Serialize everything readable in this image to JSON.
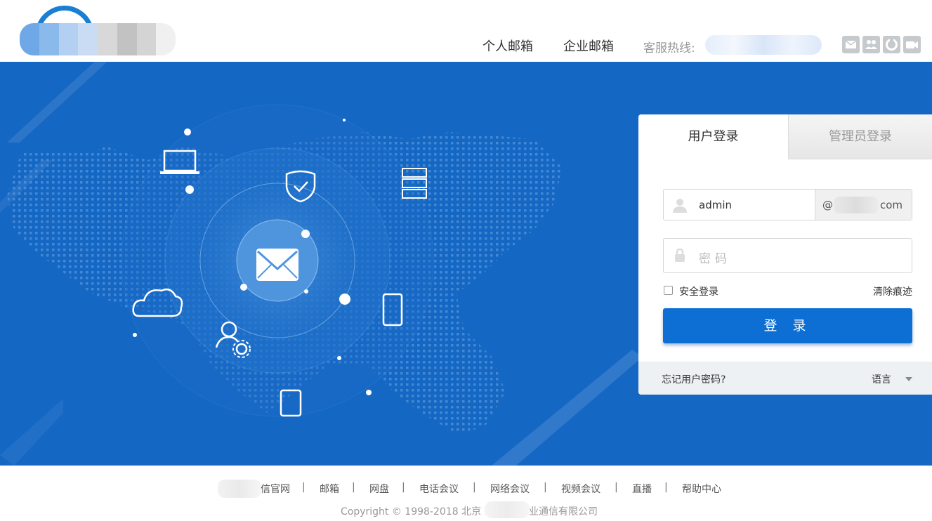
{
  "header": {
    "nav_personal": "个人邮箱",
    "nav_enterprise": "企业邮箱",
    "hotline_label": "客服热线:",
    "icons": [
      "mail-icon",
      "contacts-icon",
      "sync-icon",
      "video-icon"
    ]
  },
  "login": {
    "tab_user": "用户登录",
    "tab_admin": "管理员登录",
    "username_value": "admin",
    "domain_at": "@",
    "domain_suffix": "com",
    "password_placeholder": "密码",
    "secure_login_label": "安全登录",
    "clear_traces": "清除痕迹",
    "login_button": "登 录",
    "forgot_password": "忘记用户密码?",
    "language": "语言"
  },
  "footer": {
    "links": [
      "信官网",
      "邮箱",
      "网盘",
      "电话会议",
      "网络会议",
      "视频会议",
      "直播",
      "帮助中心"
    ],
    "separator": "|",
    "copyright_prefix": "Copyright © 1998-2018 北京",
    "copyright_suffix": "业通信有限公司"
  },
  "colors": {
    "banner": "#1567c4",
    "primary_button": "#0d6fd3",
    "logo": "#1a7fd4"
  }
}
